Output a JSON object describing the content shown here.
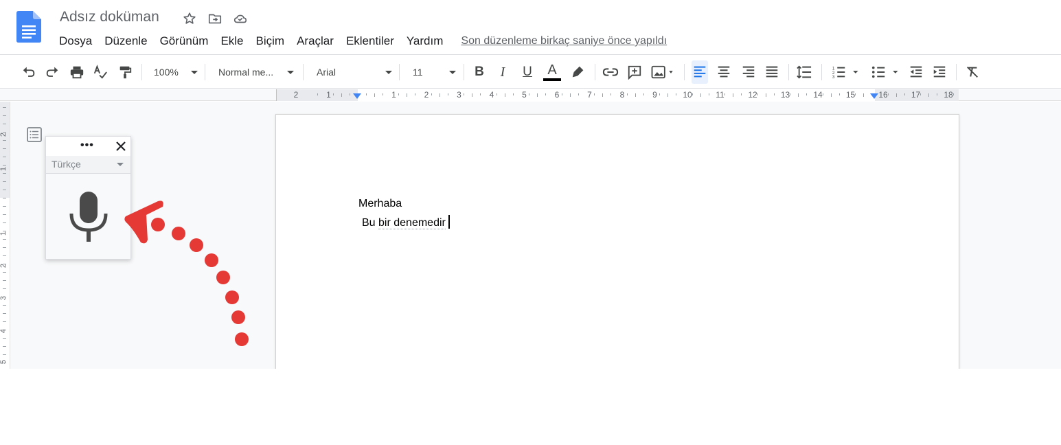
{
  "header": {
    "title": "Adsız doküman",
    "icons": [
      "star-icon",
      "move-to-folder-icon",
      "cloud-saved-icon"
    ],
    "menu": [
      "Dosya",
      "Düzenle",
      "Görünüm",
      "Ekle",
      "Biçim",
      "Araçlar",
      "Eklentiler",
      "Yardım"
    ],
    "last_edit": "Son düzenleme birkaç saniye önce yapıldı"
  },
  "toolbar": {
    "zoom": "100%",
    "style": "Normal me...",
    "font": "Arial",
    "font_size": "11",
    "icons": [
      "undo-icon",
      "redo-icon",
      "print-icon",
      "spellcheck-icon",
      "paint-format-icon",
      "bold-icon",
      "italic-icon",
      "underline-icon",
      "text-color-icon",
      "highlight-icon",
      "link-icon",
      "comment-icon",
      "image-icon",
      "align-left-icon",
      "align-center-icon",
      "align-right-icon",
      "justify-icon",
      "line-spacing-icon",
      "numbered-list-icon",
      "bulleted-list-icon",
      "decrease-indent-icon",
      "increase-indent-icon",
      "clear-formatting-icon"
    ],
    "active_alignment": "left",
    "text_color": "#000000"
  },
  "ruler": {
    "numbers": [
      "2",
      "1",
      "1",
      "2",
      "3",
      "4",
      "5",
      "6",
      "7",
      "8",
      "9",
      "10",
      "11",
      "12",
      "13",
      "14",
      "15",
      "16",
      "17",
      "18"
    ],
    "vertical_numbers": [
      "2",
      "1",
      "1",
      "2",
      "3",
      "4",
      "5"
    ]
  },
  "document": {
    "lines": [
      "Merhaba",
      "Bu bir denemedir"
    ]
  },
  "voice_typing": {
    "language": "Türkçe",
    "menu_label": "•••",
    "close_label": "✕"
  },
  "colors": {
    "accent": "#4285f4",
    "annotation": "#e53935",
    "doc_icon": "#4285f4"
  }
}
